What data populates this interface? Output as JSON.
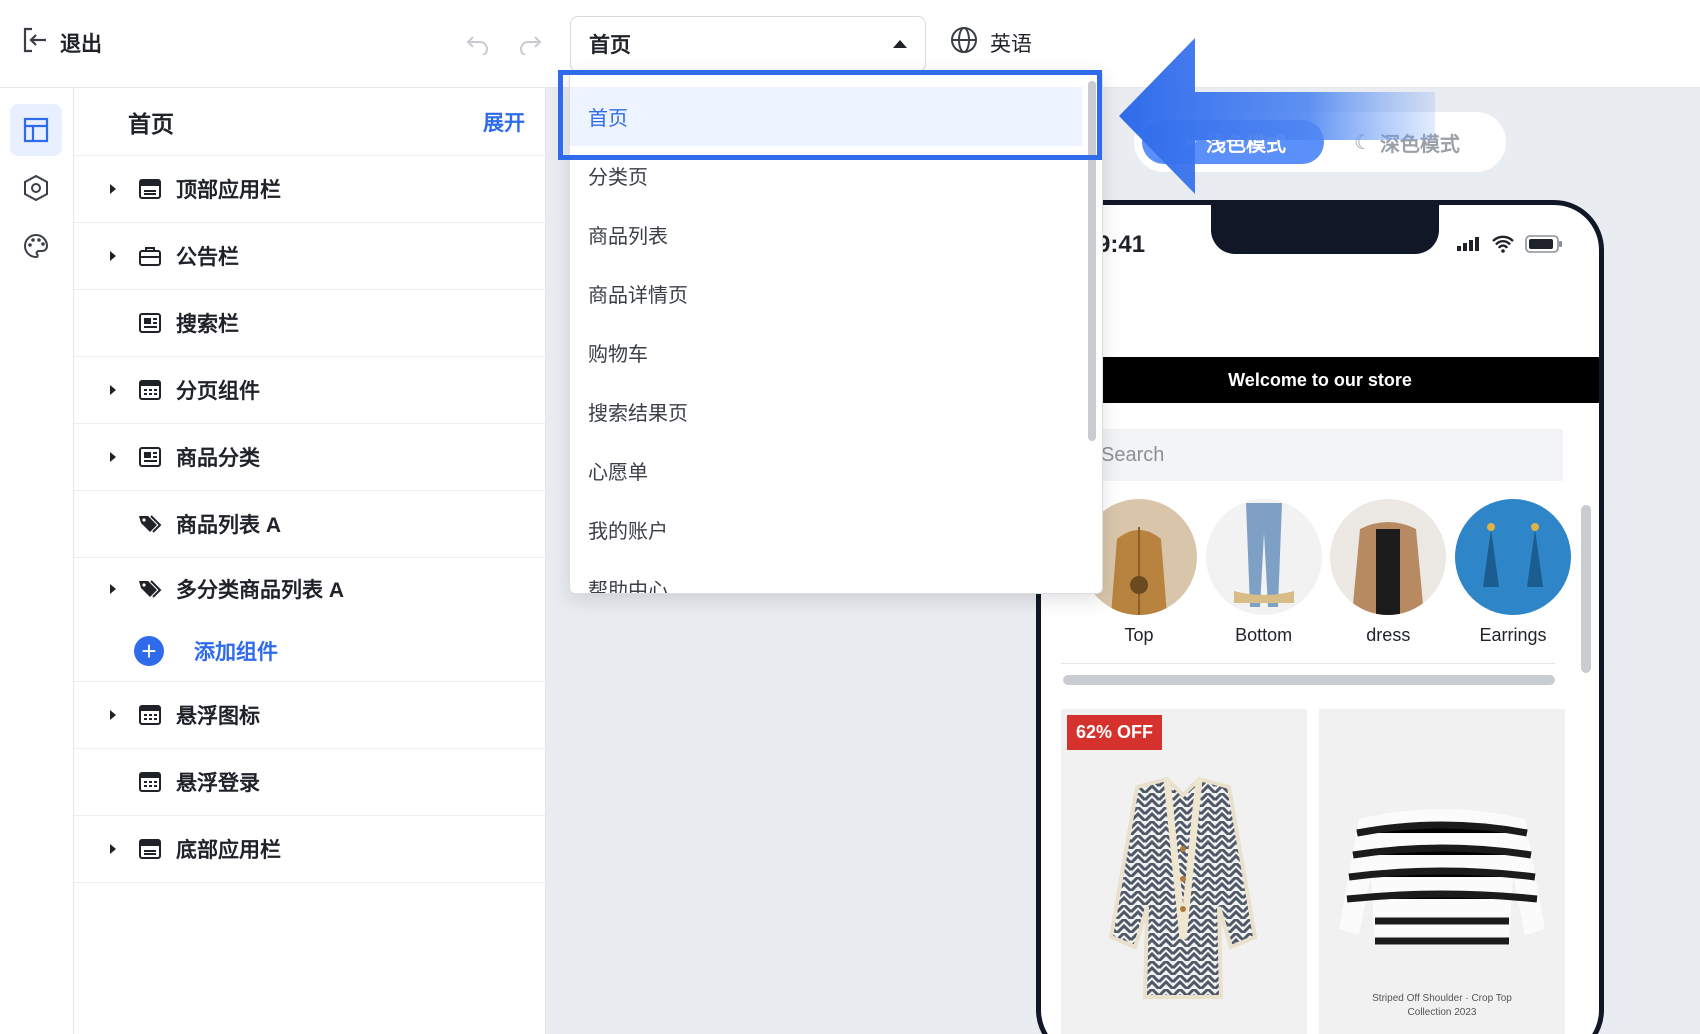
{
  "topbar": {
    "exit_label": "退出",
    "page_select_value": "首页",
    "language_label": "英语"
  },
  "tree": {
    "title": "首页",
    "expand_label": "展开",
    "items": [
      {
        "label": "顶部应用栏",
        "icon": "app-bar-icon",
        "expandable": true
      },
      {
        "label": "公告栏",
        "icon": "announcement-icon",
        "expandable": true
      },
      {
        "label": "搜索栏",
        "icon": "search-bar-icon",
        "expandable": false
      },
      {
        "label": "分页组件",
        "icon": "pagination-icon",
        "expandable": true
      },
      {
        "label": "商品分类",
        "icon": "category-icon",
        "expandable": true
      },
      {
        "label": "商品列表 A",
        "icon": "tag-icon",
        "expandable": false
      },
      {
        "label": "多分类商品列表 A",
        "icon": "tag-icon",
        "expandable": true
      }
    ],
    "add_component_label": "添加组件",
    "bottom_items": [
      {
        "label": "悬浮图标",
        "icon": "float-icon",
        "expandable": true
      },
      {
        "label": "悬浮登录",
        "icon": "float-login-icon",
        "expandable": false
      },
      {
        "label": "底部应用栏",
        "icon": "bottom-bar-icon",
        "expandable": true
      }
    ]
  },
  "dropdown": {
    "options": [
      "首页",
      "分类页",
      "商品列表",
      "商品详情页",
      "购物车",
      "搜索结果页",
      "心愿单",
      "我的账户",
      "帮助中心"
    ],
    "selected": "首页"
  },
  "theme": {
    "light_label": "浅色模式",
    "dark_label": "深色模式"
  },
  "preview": {
    "time": "9:41",
    "welcome_text": "Welcome to our store",
    "search_placeholder": "Search",
    "categories": [
      {
        "name": "Top",
        "color": "#b8823f"
      },
      {
        "name": "Bottom",
        "color": "#7ea0c4"
      },
      {
        "name": "dress",
        "color": "#b88a62"
      },
      {
        "name": "Earrings",
        "color": "#2e86c9"
      }
    ],
    "products": [
      {
        "badge": "62% OFF"
      },
      {
        "caption_line1": "Striped Off Shoulder · Crop Top",
        "caption_line2": "Collection 2023"
      }
    ]
  },
  "colors": {
    "accent": "#2f6bea",
    "badge": "#d6322d",
    "phone_frame": "#101828"
  }
}
